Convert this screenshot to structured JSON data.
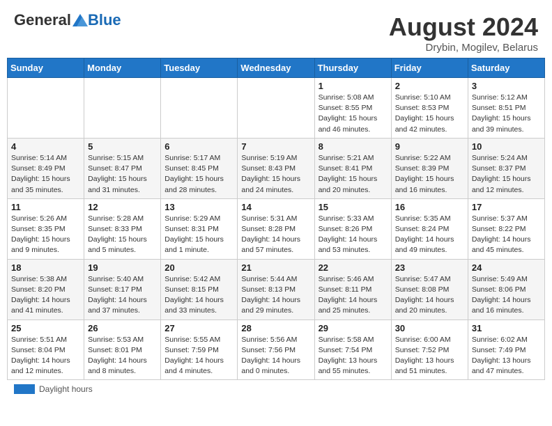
{
  "header": {
    "logo_general": "General",
    "logo_blue": "Blue",
    "month_year": "August 2024",
    "location": "Drybin, Mogilev, Belarus"
  },
  "footer": {
    "daylight_label": "Daylight hours"
  },
  "weekdays": [
    "Sunday",
    "Monday",
    "Tuesday",
    "Wednesday",
    "Thursday",
    "Friday",
    "Saturday"
  ],
  "weeks": [
    [
      {
        "day": "",
        "info": ""
      },
      {
        "day": "",
        "info": ""
      },
      {
        "day": "",
        "info": ""
      },
      {
        "day": "",
        "info": ""
      },
      {
        "day": "1",
        "info": "Sunrise: 5:08 AM\nSunset: 8:55 PM\nDaylight: 15 hours and 46 minutes."
      },
      {
        "day": "2",
        "info": "Sunrise: 5:10 AM\nSunset: 8:53 PM\nDaylight: 15 hours and 42 minutes."
      },
      {
        "day": "3",
        "info": "Sunrise: 5:12 AM\nSunset: 8:51 PM\nDaylight: 15 hours and 39 minutes."
      }
    ],
    [
      {
        "day": "4",
        "info": "Sunrise: 5:14 AM\nSunset: 8:49 PM\nDaylight: 15 hours and 35 minutes."
      },
      {
        "day": "5",
        "info": "Sunrise: 5:15 AM\nSunset: 8:47 PM\nDaylight: 15 hours and 31 minutes."
      },
      {
        "day": "6",
        "info": "Sunrise: 5:17 AM\nSunset: 8:45 PM\nDaylight: 15 hours and 28 minutes."
      },
      {
        "day": "7",
        "info": "Sunrise: 5:19 AM\nSunset: 8:43 PM\nDaylight: 15 hours and 24 minutes."
      },
      {
        "day": "8",
        "info": "Sunrise: 5:21 AM\nSunset: 8:41 PM\nDaylight: 15 hours and 20 minutes."
      },
      {
        "day": "9",
        "info": "Sunrise: 5:22 AM\nSunset: 8:39 PM\nDaylight: 15 hours and 16 minutes."
      },
      {
        "day": "10",
        "info": "Sunrise: 5:24 AM\nSunset: 8:37 PM\nDaylight: 15 hours and 12 minutes."
      }
    ],
    [
      {
        "day": "11",
        "info": "Sunrise: 5:26 AM\nSunset: 8:35 PM\nDaylight: 15 hours and 9 minutes."
      },
      {
        "day": "12",
        "info": "Sunrise: 5:28 AM\nSunset: 8:33 PM\nDaylight: 15 hours and 5 minutes."
      },
      {
        "day": "13",
        "info": "Sunrise: 5:29 AM\nSunset: 8:31 PM\nDaylight: 15 hours and 1 minute."
      },
      {
        "day": "14",
        "info": "Sunrise: 5:31 AM\nSunset: 8:28 PM\nDaylight: 14 hours and 57 minutes."
      },
      {
        "day": "15",
        "info": "Sunrise: 5:33 AM\nSunset: 8:26 PM\nDaylight: 14 hours and 53 minutes."
      },
      {
        "day": "16",
        "info": "Sunrise: 5:35 AM\nSunset: 8:24 PM\nDaylight: 14 hours and 49 minutes."
      },
      {
        "day": "17",
        "info": "Sunrise: 5:37 AM\nSunset: 8:22 PM\nDaylight: 14 hours and 45 minutes."
      }
    ],
    [
      {
        "day": "18",
        "info": "Sunrise: 5:38 AM\nSunset: 8:20 PM\nDaylight: 14 hours and 41 minutes."
      },
      {
        "day": "19",
        "info": "Sunrise: 5:40 AM\nSunset: 8:17 PM\nDaylight: 14 hours and 37 minutes."
      },
      {
        "day": "20",
        "info": "Sunrise: 5:42 AM\nSunset: 8:15 PM\nDaylight: 14 hours and 33 minutes."
      },
      {
        "day": "21",
        "info": "Sunrise: 5:44 AM\nSunset: 8:13 PM\nDaylight: 14 hours and 29 minutes."
      },
      {
        "day": "22",
        "info": "Sunrise: 5:46 AM\nSunset: 8:11 PM\nDaylight: 14 hours and 25 minutes."
      },
      {
        "day": "23",
        "info": "Sunrise: 5:47 AM\nSunset: 8:08 PM\nDaylight: 14 hours and 20 minutes."
      },
      {
        "day": "24",
        "info": "Sunrise: 5:49 AM\nSunset: 8:06 PM\nDaylight: 14 hours and 16 minutes."
      }
    ],
    [
      {
        "day": "25",
        "info": "Sunrise: 5:51 AM\nSunset: 8:04 PM\nDaylight: 14 hours and 12 minutes."
      },
      {
        "day": "26",
        "info": "Sunrise: 5:53 AM\nSunset: 8:01 PM\nDaylight: 14 hours and 8 minutes."
      },
      {
        "day": "27",
        "info": "Sunrise: 5:55 AM\nSunset: 7:59 PM\nDaylight: 14 hours and 4 minutes."
      },
      {
        "day": "28",
        "info": "Sunrise: 5:56 AM\nSunset: 7:56 PM\nDaylight: 14 hours and 0 minutes."
      },
      {
        "day": "29",
        "info": "Sunrise: 5:58 AM\nSunset: 7:54 PM\nDaylight: 13 hours and 55 minutes."
      },
      {
        "day": "30",
        "info": "Sunrise: 6:00 AM\nSunset: 7:52 PM\nDaylight: 13 hours and 51 minutes."
      },
      {
        "day": "31",
        "info": "Sunrise: 6:02 AM\nSunset: 7:49 PM\nDaylight: 13 hours and 47 minutes."
      }
    ]
  ]
}
